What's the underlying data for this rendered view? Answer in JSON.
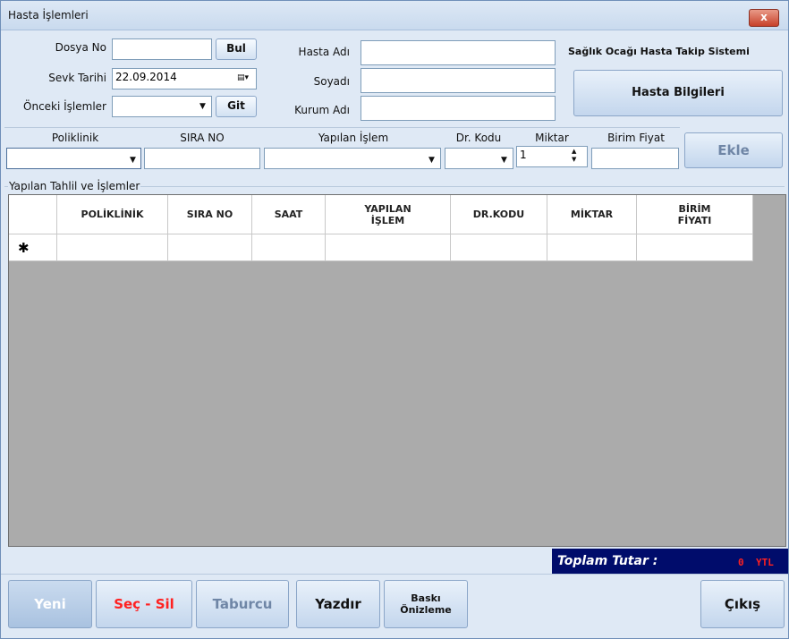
{
  "window": {
    "title": "Hasta İşlemleri",
    "close_label": "x"
  },
  "top": {
    "dosya_no_label": "Dosya No",
    "bul_label": "Bul",
    "sevk_tarihi_label": "Sevk Tarihi",
    "sevk_tarihi_value": "22.09.2014",
    "onceki_islemler_label": "Önceki İşlemler",
    "git_label": "Git",
    "hasta_adi_label": "Hasta Adı",
    "soyadi_label": "Soyadı",
    "kurum_adi_label": "Kurum Adı",
    "system_title": "Sağlık Ocağı Hasta Takip Sistemi",
    "hasta_bilgileri_label": "Hasta Bilgileri"
  },
  "entry": {
    "poliklinik_label": "Poliklinik",
    "sira_no_label": "SIRA NO",
    "yapilan_islem_label": "Yapılan İşlem",
    "dr_kodu_label": "Dr. Kodu",
    "miktar_label": "Miktar",
    "miktar_value": "1",
    "birim_fiyat_label": "Birim Fiyat",
    "ekle_label": "Ekle"
  },
  "grid": {
    "group_title": "Yapılan Tahlil ve İşlemler",
    "columns": [
      "POLİKLİNİK",
      "SIRA NO",
      "SAAT",
      "YAPILAN İŞLEM",
      "DR.KODU",
      "MİKTAR",
      "BİRİM FİYATI"
    ],
    "new_row_marker": "✱"
  },
  "totals": {
    "label": "Toplam Tutar :",
    "value": "0",
    "currency": "YTL"
  },
  "buttons": {
    "yeni": "Yeni",
    "sec_sil": "Seç - Sil",
    "taburcu": "Taburcu",
    "yazdir": "Yazdır",
    "baski_line1": "Baskı",
    "baski_line2": "Önizleme",
    "cikis": "Çıkış"
  },
  "colors": {
    "sec_sil": "#ff2020",
    "total_value": "#ff2020",
    "disabled_text": "#6f86a6"
  }
}
